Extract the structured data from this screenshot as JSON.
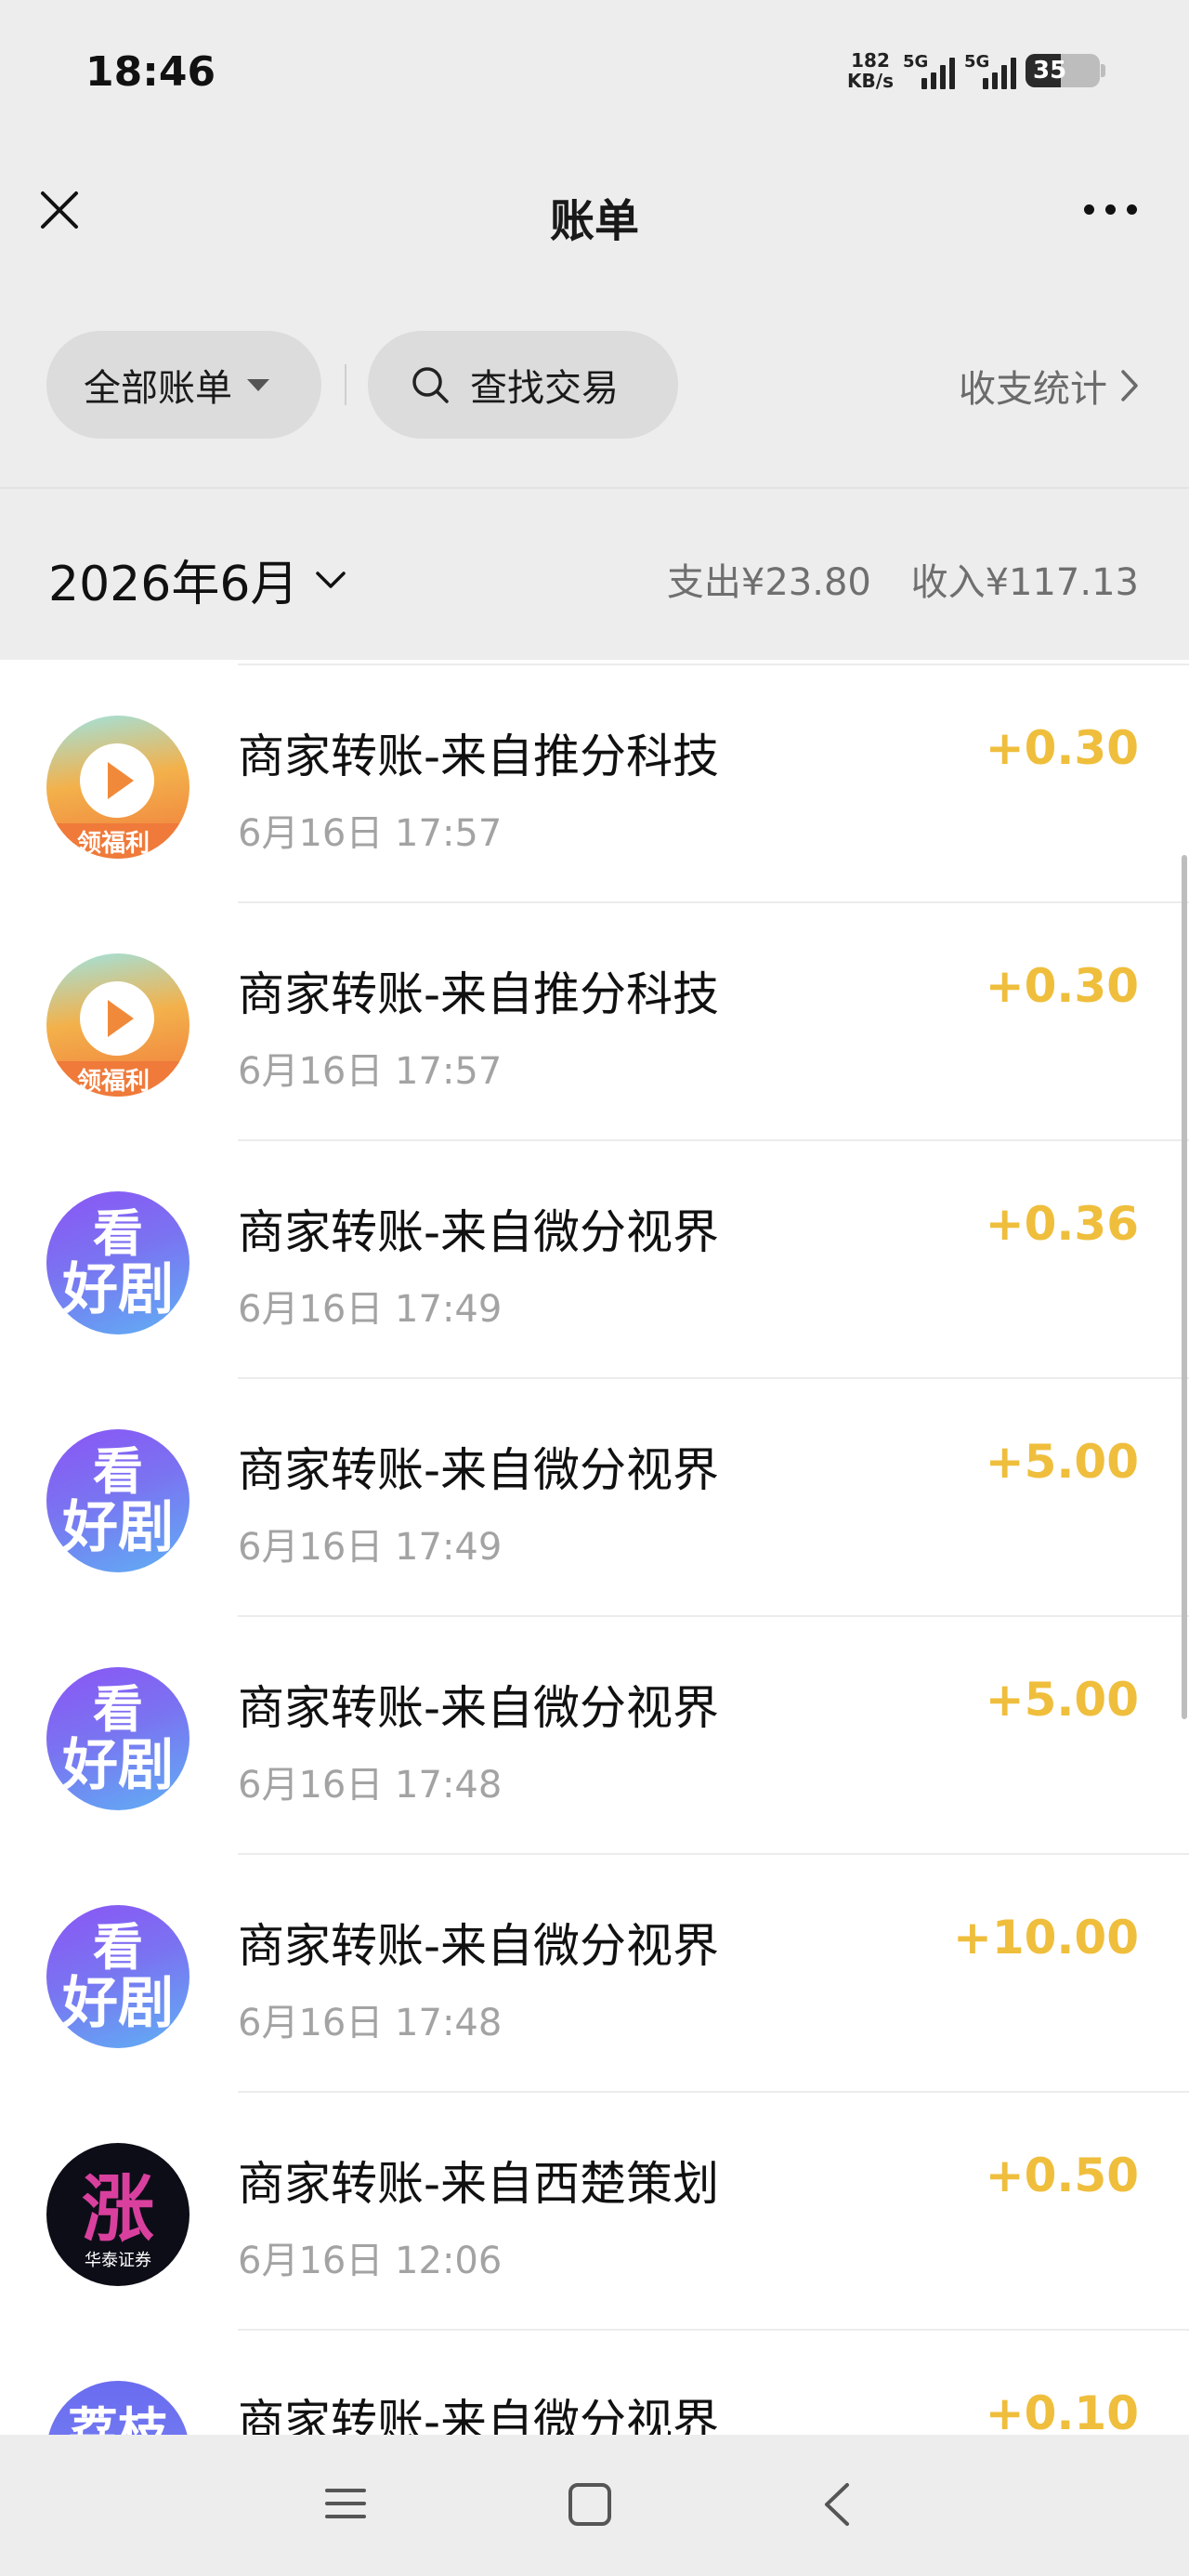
{
  "status": {
    "time": "18:46",
    "net_speed_value": "182",
    "net_speed_unit": "KB/s",
    "sim1": "5G",
    "sim2": "5G",
    "battery": "35"
  },
  "nav": {
    "title": "账单"
  },
  "filters": {
    "all_bills": "全部账单",
    "search": "查找交易",
    "stats": "收支统计"
  },
  "month": {
    "label": "2026年6月",
    "expense": "支出¥23.80",
    "income": "收入¥117.13"
  },
  "transactions": [
    {
      "title": "商家转账-来自推分科技",
      "time": "6月16日 17:57",
      "amount": "+0.30",
      "avatar": "video-welfare",
      "avatar_text": "领福利"
    },
    {
      "title": "商家转账-来自推分科技",
      "time": "6月16日 17:57",
      "amount": "+0.30",
      "avatar": "video-welfare",
      "avatar_text": "领福利"
    },
    {
      "title": "商家转账-来自微分视界",
      "time": "6月16日 17:49",
      "amount": "+0.36",
      "avatar": "drama",
      "avatar_line1": "看",
      "avatar_line2": "好剧"
    },
    {
      "title": "商家转账-来自微分视界",
      "time": "6月16日 17:49",
      "amount": "+5.00",
      "avatar": "drama",
      "avatar_line1": "看",
      "avatar_line2": "好剧"
    },
    {
      "title": "商家转账-来自微分视界",
      "time": "6月16日 17:48",
      "amount": "+5.00",
      "avatar": "drama",
      "avatar_line1": "看",
      "avatar_line2": "好剧"
    },
    {
      "title": "商家转账-来自微分视界",
      "time": "6月16日 17:48",
      "amount": "+10.00",
      "avatar": "drama",
      "avatar_line1": "看",
      "avatar_line2": "好剧"
    },
    {
      "title": "商家转账-来自西楚策划",
      "time": "6月16日 12:06",
      "amount": "+0.50",
      "avatar": "zhang",
      "avatar_text": "华泰证券"
    },
    {
      "title": "商家转账-来自微分视界",
      "time": "",
      "amount": "+0.10",
      "avatar": "lizhi",
      "avatar_text": "荔枝"
    }
  ],
  "colors": {
    "income_amount": "#efbe3c",
    "background": "#ededed"
  }
}
